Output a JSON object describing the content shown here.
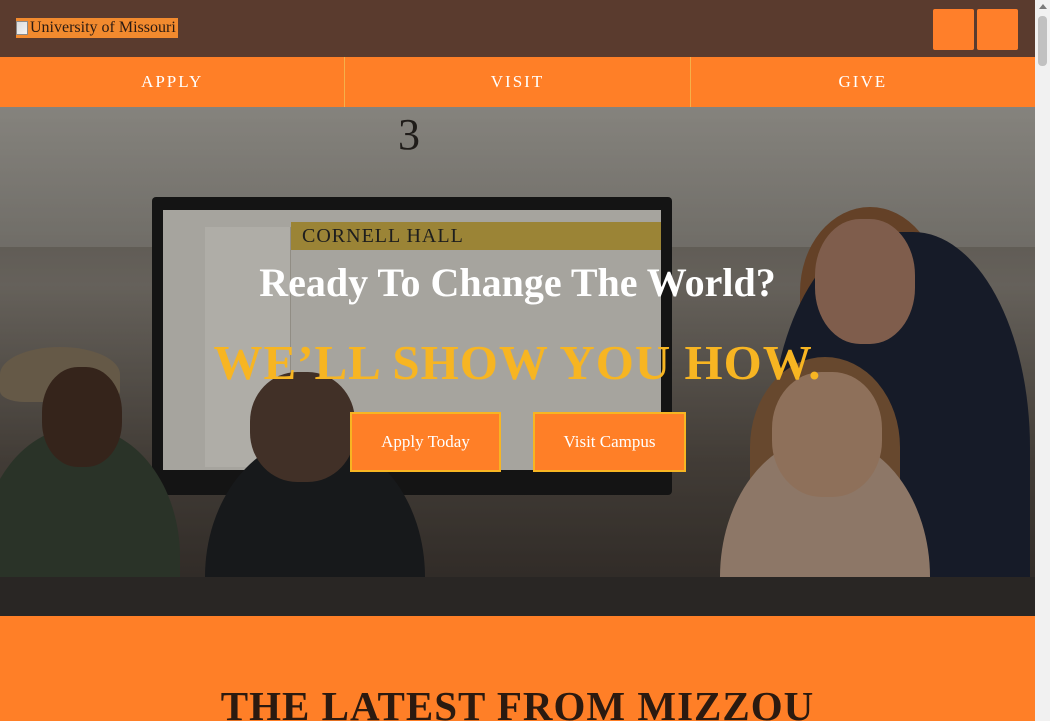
{
  "header": {
    "logo_alt": "University of Missouri",
    "search_icon": "search-icon",
    "menu_icon": "menu-icon"
  },
  "nav": {
    "items": [
      {
        "label": "APPLY"
      },
      {
        "label": "VISIT"
      },
      {
        "label": "GIVE"
      }
    ]
  },
  "hero": {
    "title": "Ready To Change The World?",
    "subtitle": "WE’LL SHOW YOU HOW.",
    "buttons": {
      "apply": "Apply Today",
      "visit": "Visit Campus"
    },
    "photo": {
      "room_number": "3",
      "screen_heading": "CORNELL HALL"
    }
  },
  "latest": {
    "title": "THE LATEST FROM MIZZOU"
  },
  "colors": {
    "brown": "#5a3b2e",
    "orange": "#ff7f27",
    "gold": "#f7b522"
  }
}
